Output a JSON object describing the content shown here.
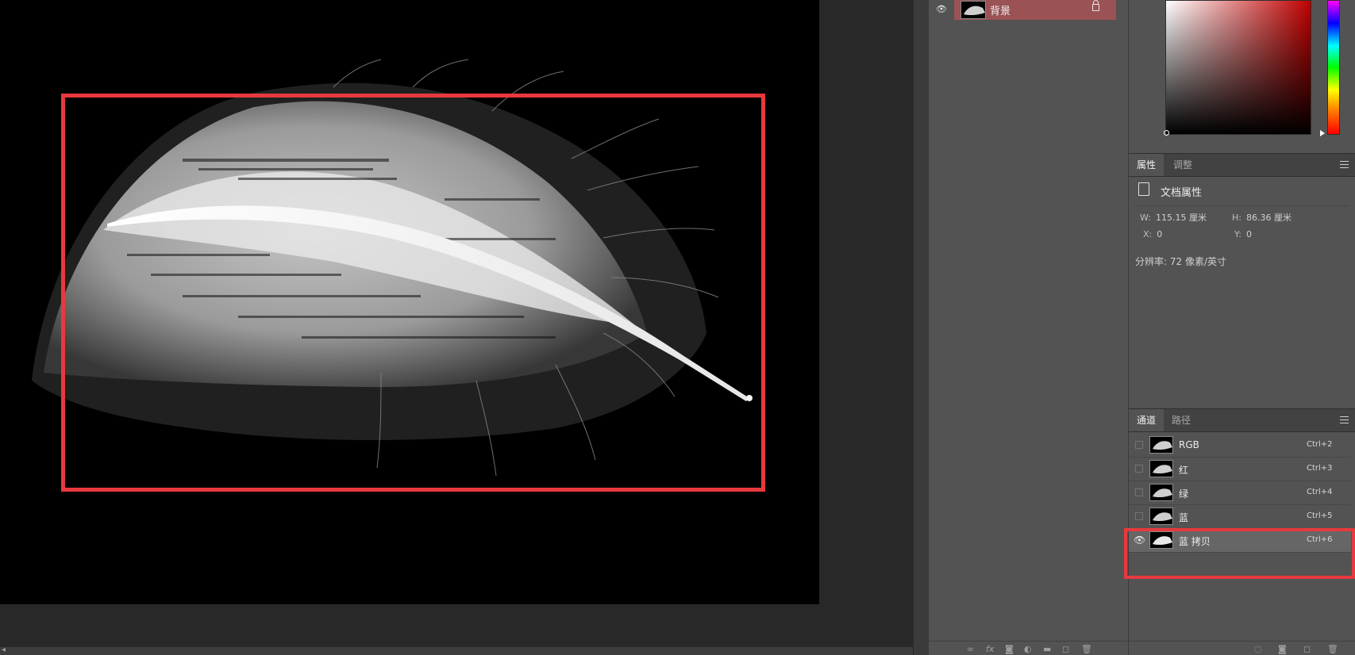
{
  "layers_panel": {
    "layer_name": "背景",
    "footer_icons": [
      "link-icon",
      "fx-icon",
      "mask-icon",
      "adjustment-icon",
      "folder-icon",
      "new-layer-icon",
      "trash-icon"
    ]
  },
  "properties_panel": {
    "tabs": [
      "属性",
      "调整"
    ],
    "section_label": "文档属性",
    "width_label": "W:",
    "width_value": "115.15 厘米",
    "height_label": "H:",
    "height_value": "86.36 厘米",
    "x_label": "X:",
    "x_value": "0",
    "y_label": "Y:",
    "y_value": "0",
    "resolution": "分辨率: 72 像素/英寸"
  },
  "channels_panel": {
    "tabs": [
      "通道",
      "路径"
    ],
    "channels": [
      {
        "name": "RGB",
        "shortcut": "Ctrl+2",
        "visible": false
      },
      {
        "name": "红",
        "shortcut": "Ctrl+3",
        "visible": false
      },
      {
        "name": "绿",
        "shortcut": "Ctrl+4",
        "visible": false
      },
      {
        "name": "蓝",
        "shortcut": "Ctrl+5",
        "visible": false
      },
      {
        "name": "蓝 拷贝",
        "shortcut": "Ctrl+6",
        "visible": true
      }
    ],
    "footer_icons": [
      "load-selection-icon",
      "save-selection-icon",
      "new-channel-icon",
      "delete-channel-icon"
    ]
  },
  "colors": {
    "highlight": "#e8393d",
    "layer_selected": "#9b5254",
    "panel_bg": "#535353"
  }
}
